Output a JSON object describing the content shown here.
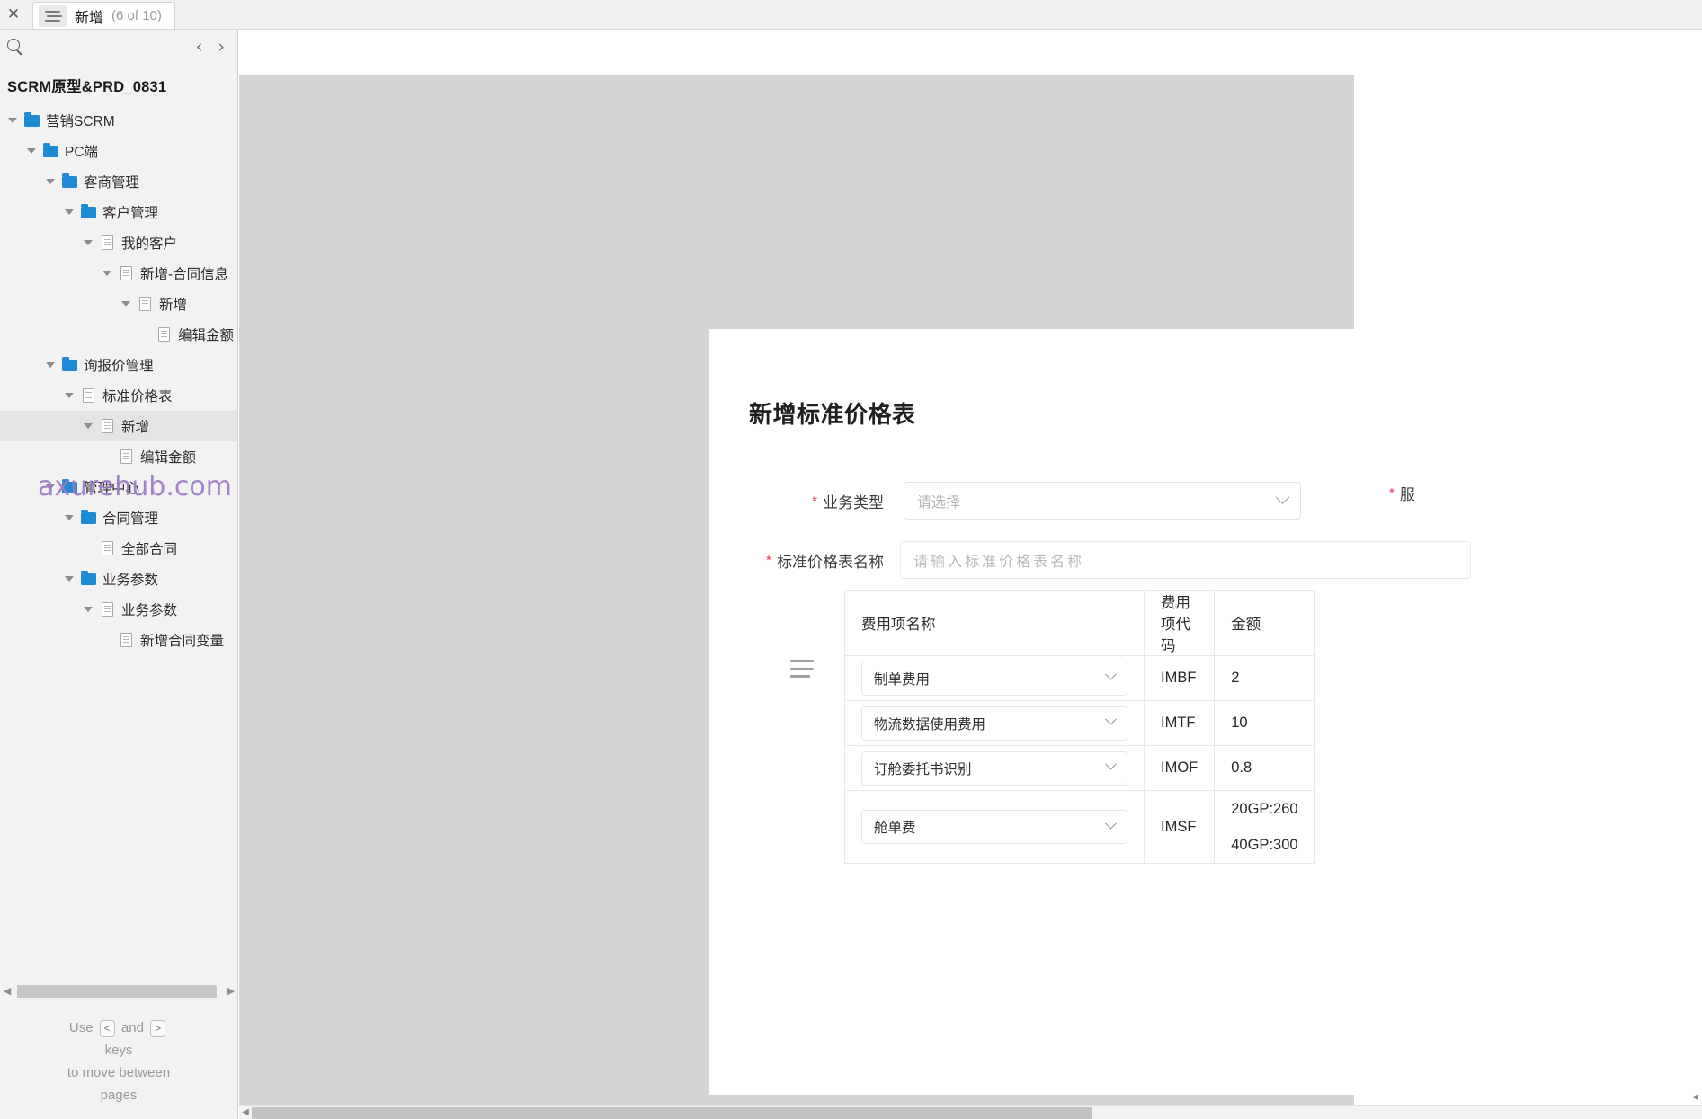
{
  "window": {
    "close_label": "✕",
    "tab": {
      "icon": "list-menu-icon",
      "title": "新增",
      "counter": "(6 of 10)"
    }
  },
  "sidebar": {
    "search_icon": "search-icon",
    "nav_prev": "‹",
    "nav_next": "›",
    "project_title": "SCRM原型&PRD_0831",
    "tree": [
      {
        "label": "营销SCRM",
        "depth": 0,
        "icon": "folder",
        "caret": true,
        "selected": false
      },
      {
        "label": "PC端",
        "depth": 1,
        "icon": "folder",
        "caret": true,
        "selected": false
      },
      {
        "label": "客商管理",
        "depth": 2,
        "icon": "folder",
        "caret": true,
        "selected": false
      },
      {
        "label": "客户管理",
        "depth": 3,
        "icon": "folder",
        "caret": true,
        "selected": false
      },
      {
        "label": "我的客户",
        "depth": 4,
        "icon": "page",
        "caret": true,
        "selected": false
      },
      {
        "label": "新增-合同信息",
        "depth": 5,
        "icon": "page",
        "caret": true,
        "selected": false
      },
      {
        "label": "新增",
        "depth": 6,
        "icon": "page",
        "caret": true,
        "selected": false
      },
      {
        "label": "编辑金额",
        "depth": 7,
        "icon": "page",
        "caret": false,
        "selected": false
      },
      {
        "label": "询报价管理",
        "depth": 2,
        "icon": "folder",
        "caret": true,
        "selected": false
      },
      {
        "label": "标准价格表",
        "depth": 3,
        "icon": "page",
        "caret": true,
        "selected": false
      },
      {
        "label": "新增",
        "depth": 4,
        "icon": "page",
        "caret": true,
        "selected": true
      },
      {
        "label": "编辑金额",
        "depth": 5,
        "icon": "page",
        "caret": false,
        "selected": false
      },
      {
        "label": "管理中心",
        "depth": 2,
        "icon": "folder",
        "caret": true,
        "selected": false
      },
      {
        "label": "合同管理",
        "depth": 3,
        "icon": "folder",
        "caret": true,
        "selected": false
      },
      {
        "label": "全部合同",
        "depth": 4,
        "icon": "page",
        "caret": false,
        "selected": false
      },
      {
        "label": "业务参数",
        "depth": 3,
        "icon": "folder",
        "caret": true,
        "selected": false
      },
      {
        "label": "业务参数",
        "depth": 4,
        "icon": "page",
        "caret": true,
        "selected": false
      },
      {
        "label": "新增合同变量",
        "depth": 5,
        "icon": "page",
        "caret": false,
        "selected": false
      }
    ],
    "help": {
      "line1_pre": "Use",
      "key_prev": "<",
      "line1_mid": "and",
      "key_next": ">",
      "line2": "keys",
      "line3": "to move between",
      "line4": "pages"
    }
  },
  "watermark": "axurehub.com 原型资源站",
  "form": {
    "title": "新增标准价格表",
    "business_type": {
      "required": "*",
      "label": "业务类型",
      "placeholder": "请选择",
      "value": ""
    },
    "service_field": {
      "required": "*",
      "label": "服"
    },
    "price_name": {
      "required": "*",
      "label": "标准价格表名称",
      "placeholder": "请输入标准价格表名称",
      "value": ""
    },
    "table": {
      "drag_handle": "drag-handle-icon",
      "columns": [
        "费用项名称",
        "费用项代码",
        "金额"
      ],
      "rows": [
        {
          "name": "制单费用",
          "code": "IMBF",
          "amount": "2",
          "amount_lines": [
            "2"
          ]
        },
        {
          "name": "物流数据使用费用",
          "code": "IMTF",
          "amount": "10",
          "amount_lines": [
            "10"
          ]
        },
        {
          "name": "订舱委托书识别",
          "code": "IMOF",
          "amount": "0.8",
          "amount_lines": [
            "0.8"
          ]
        },
        {
          "name": "舱单费",
          "code": "IMSF",
          "amount": "20GP:260 40GP:300",
          "amount_lines": [
            "20GP:260",
            "40GP:300"
          ]
        }
      ]
    }
  },
  "colors": {
    "folder_blue": "#1e8ad6",
    "required_red": "#e0394a",
    "watermark_purple": "#9c7cc4",
    "canvas_gray": "#d4d4d4",
    "panel_gray": "#f2f2f2"
  }
}
